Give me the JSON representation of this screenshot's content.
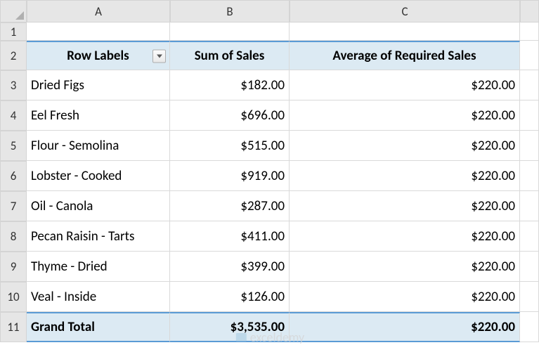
{
  "columns": [
    "A",
    "B",
    "C"
  ],
  "row_numbers": [
    "1",
    "2",
    "3",
    "4",
    "5",
    "6",
    "7",
    "8",
    "9",
    "10",
    "11"
  ],
  "headers": {
    "a": "Row Labels",
    "b": "Sum of Sales",
    "c": "Average of Required Sales"
  },
  "rows": [
    {
      "label": "Dried Figs",
      "sales": "$182.00",
      "avg": "$220.00"
    },
    {
      "label": "Eel Fresh",
      "sales": "$696.00",
      "avg": "$220.00"
    },
    {
      "label": "Flour - Semolina",
      "sales": "$515.00",
      "avg": "$220.00"
    },
    {
      "label": "Lobster - Cooked",
      "sales": "$919.00",
      "avg": "$220.00"
    },
    {
      "label": "Oil - Canola",
      "sales": "$287.00",
      "avg": "$220.00"
    },
    {
      "label": "Pecan Raisin - Tarts",
      "sales": "$411.00",
      "avg": "$220.00"
    },
    {
      "label": "Thyme - Dried",
      "sales": "$399.00",
      "avg": "$220.00"
    },
    {
      "label": "Veal - Inside",
      "sales": "$126.00",
      "avg": "$220.00"
    }
  ],
  "grand_total": {
    "label": "Grand Total",
    "sales": "$3,535.00",
    "avg": "$220.00"
  },
  "watermark": "exceldemy",
  "chart_data": {
    "type": "table",
    "columns": [
      "Row Labels",
      "Sum of Sales",
      "Average of Required Sales"
    ],
    "rows": [
      [
        "Dried Figs",
        182.0,
        220.0
      ],
      [
        "Eel Fresh",
        696.0,
        220.0
      ],
      [
        "Flour - Semolina",
        515.0,
        220.0
      ],
      [
        "Lobster - Cooked",
        919.0,
        220.0
      ],
      [
        "Oil - Canola",
        287.0,
        220.0
      ],
      [
        "Pecan Raisin - Tarts",
        411.0,
        220.0
      ],
      [
        "Thyme - Dried",
        399.0,
        220.0
      ],
      [
        "Veal - Inside",
        126.0,
        220.0
      ]
    ],
    "totals": [
      "Grand Total",
      3535.0,
      220.0
    ]
  }
}
